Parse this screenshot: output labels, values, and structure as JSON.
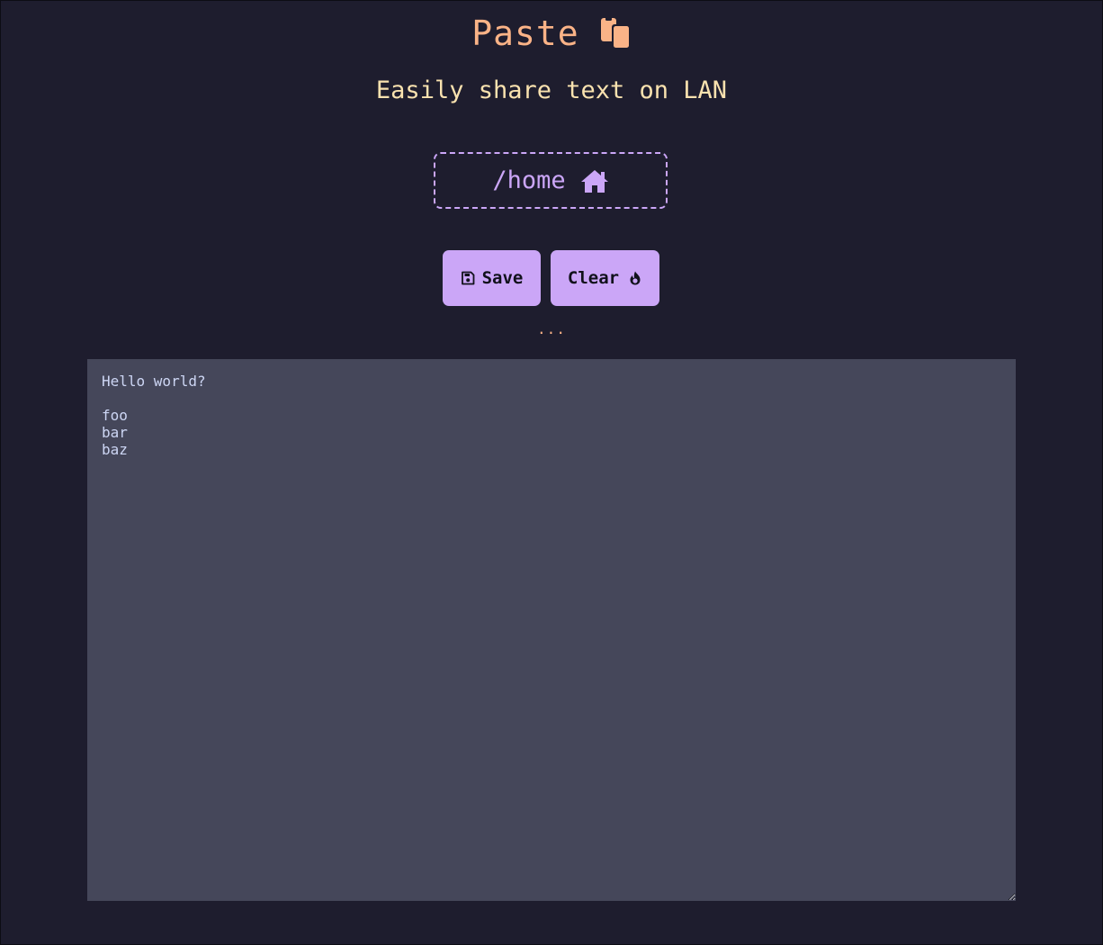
{
  "header": {
    "title": "Paste",
    "title_icon": "clipboard-icon",
    "subtitle": "Easily share text on LAN"
  },
  "path": {
    "label": "/home",
    "icon": "home-icon"
  },
  "buttons": {
    "save_label": "Save",
    "save_icon": "floppy-disk-icon",
    "clear_label": "Clear",
    "clear_icon": "fire-icon"
  },
  "status_text": "...",
  "editor": {
    "content": "Hello world?\n\nfoo\nbar\nbaz"
  },
  "colors": {
    "background": "#1e1d2e",
    "title": "#fab387",
    "subtitle": "#f9e2af",
    "accent": "#cba6f7",
    "editor_bg": "#45475a",
    "editor_text": "#cdd6f4"
  }
}
